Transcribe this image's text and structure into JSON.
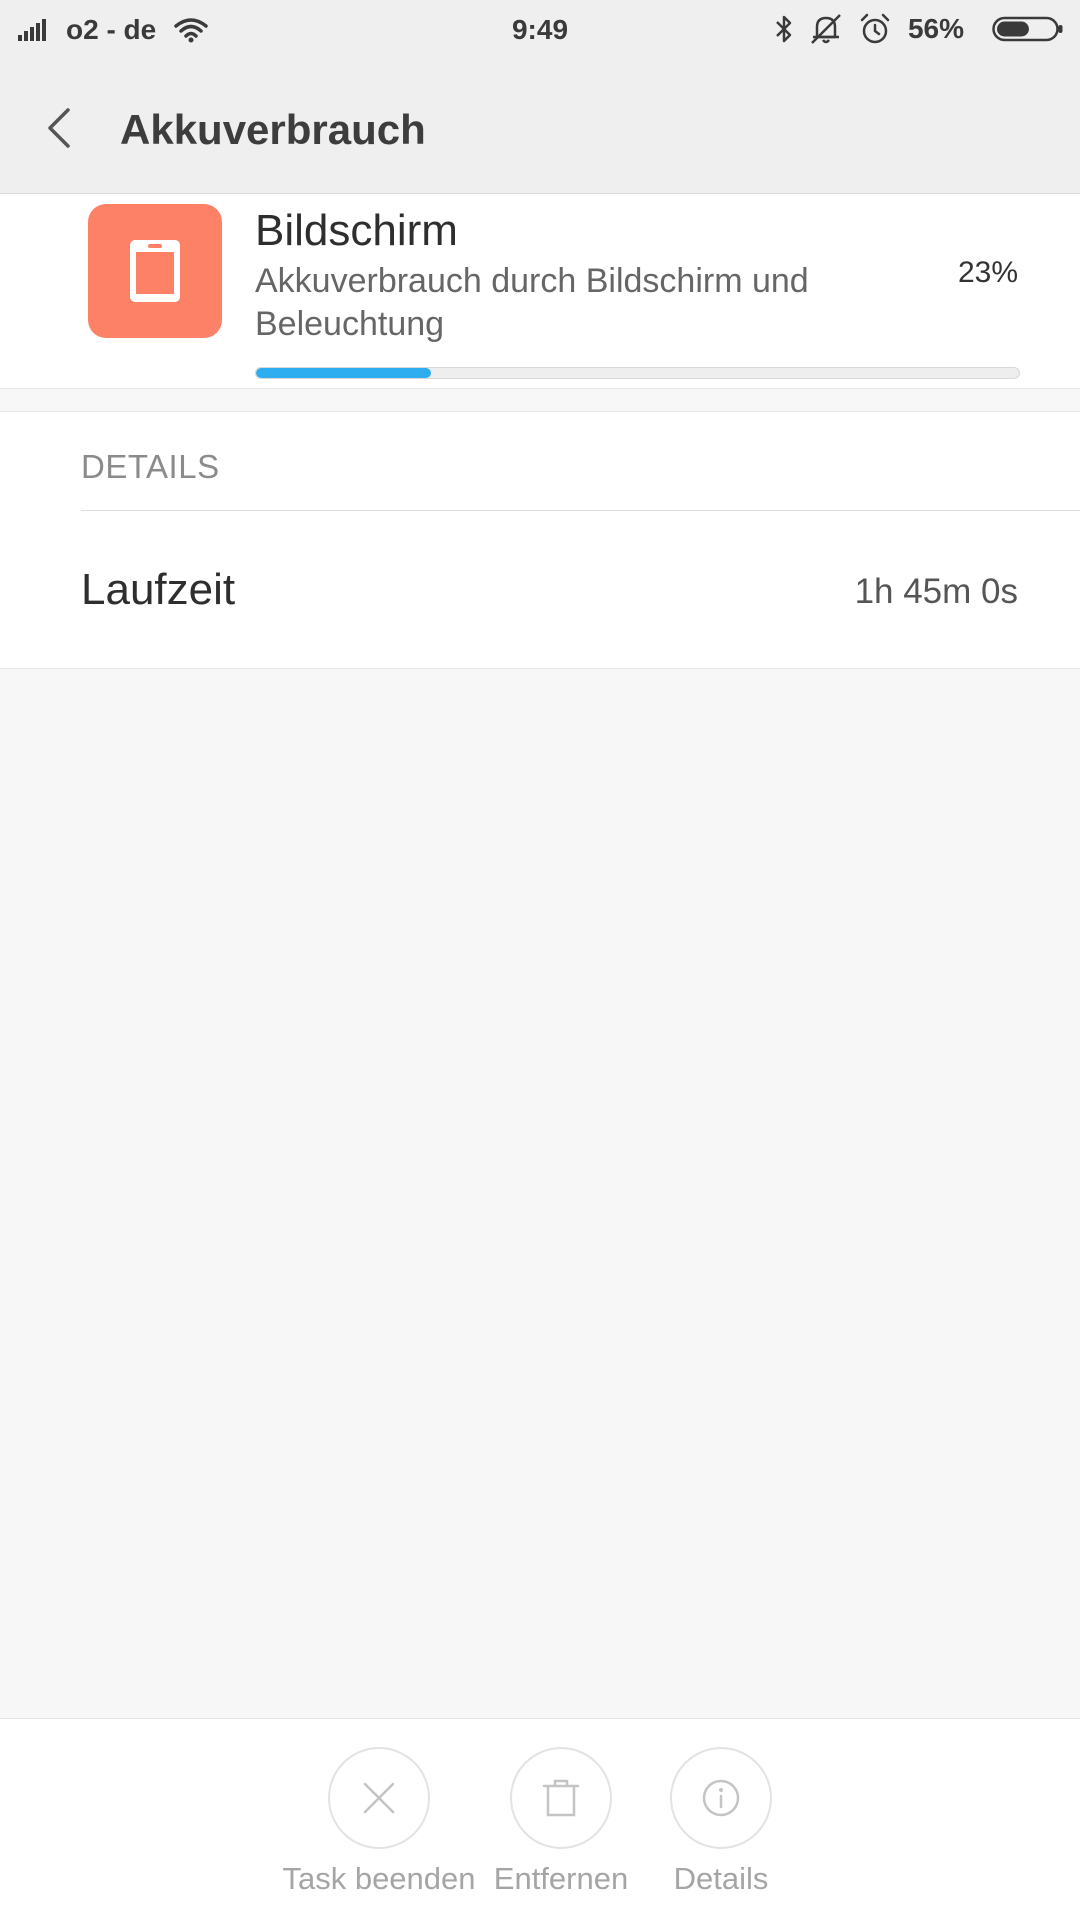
{
  "status_bar": {
    "carrier": "o2 - de",
    "time": "9:49",
    "battery_percent": "56%",
    "battery_level": 0.56,
    "icons": [
      "signal-icon",
      "wifi-icon",
      "bluetooth-icon",
      "mute-icon",
      "alarm-icon",
      "battery-icon"
    ]
  },
  "header": {
    "title": "Akkuverbrauch",
    "back_icon": "chevron-left-icon"
  },
  "app": {
    "name": "Bildschirm",
    "description": "Akkuverbrauch durch Bildschirm und Beleuchtung",
    "percent_label": "23%",
    "usage_fraction": 0.23,
    "icon": "tablet-icon",
    "icon_color": "#fd8167",
    "progress_color": "#2eaef0"
  },
  "details": {
    "header": "DETAILS",
    "rows": [
      {
        "label": "Laufzeit",
        "value": "1h 45m 0s"
      }
    ]
  },
  "actions": [
    {
      "label": "Task beenden",
      "icon": "close-icon"
    },
    {
      "label": "Entfernen",
      "icon": "trash-icon"
    },
    {
      "label": "Details",
      "icon": "info-icon"
    }
  ]
}
